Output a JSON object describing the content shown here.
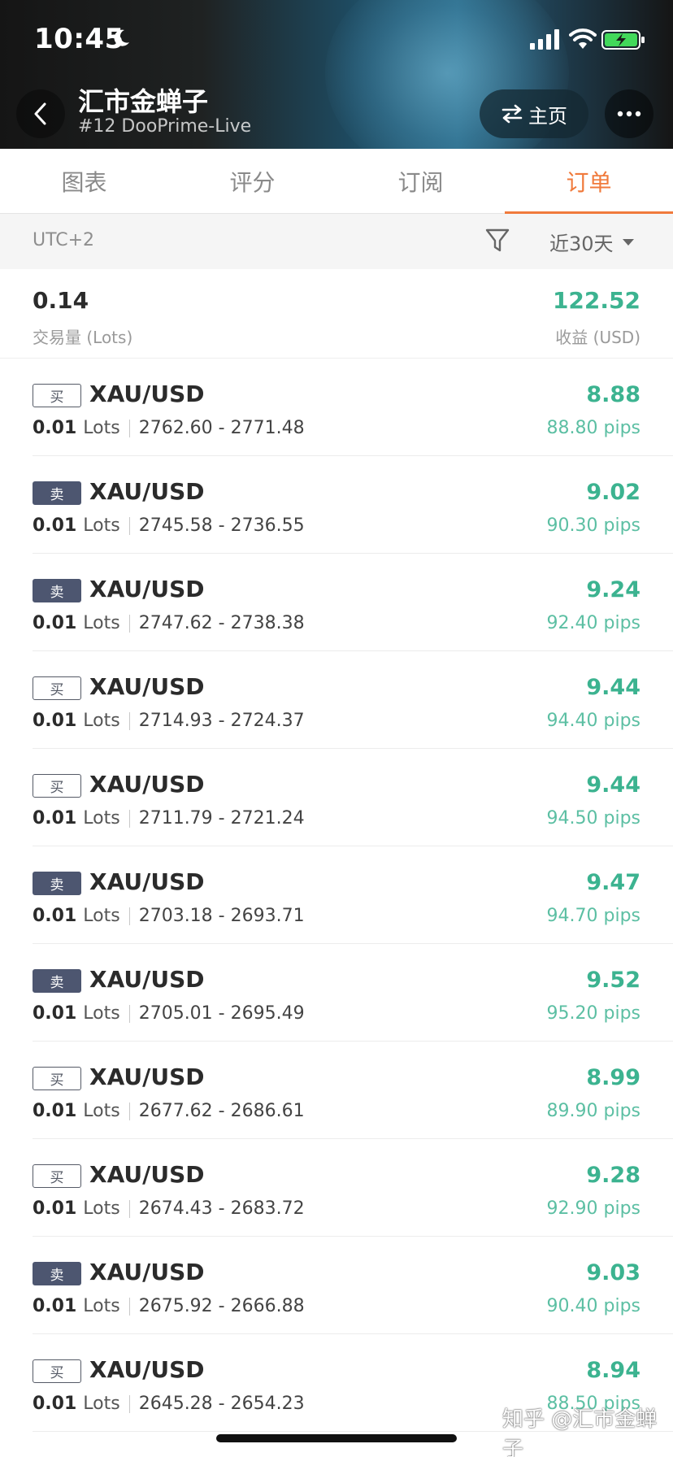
{
  "status_bar": {
    "time": "10:45"
  },
  "header": {
    "title": "汇市金蝉子",
    "subtitle": "#12 DooPrime-Live",
    "home_label": "主页"
  },
  "tabs": [
    {
      "label": "图表",
      "active": false
    },
    {
      "label": "评分",
      "active": false
    },
    {
      "label": "订阅",
      "active": false
    },
    {
      "label": "订单",
      "active": true
    }
  ],
  "filter": {
    "timezone": "UTC+2",
    "period": "近30天"
  },
  "summary": {
    "lots": "0.14",
    "lots_label": "交易量 (Lots)",
    "profit": "122.52",
    "profit_label": "收益 (USD)"
  },
  "orders": [
    {
      "side": "买",
      "type": "buy",
      "symbol": "XAU/USD",
      "lots": "0.01",
      "unit": "Lots",
      "range": "2762.60 - 2771.48",
      "profit": "8.88",
      "pips": "88.80 pips"
    },
    {
      "side": "卖",
      "type": "sell",
      "symbol": "XAU/USD",
      "lots": "0.01",
      "unit": "Lots",
      "range": "2745.58 - 2736.55",
      "profit": "9.02",
      "pips": "90.30 pips"
    },
    {
      "side": "卖",
      "type": "sell",
      "symbol": "XAU/USD",
      "lots": "0.01",
      "unit": "Lots",
      "range": "2747.62 - 2738.38",
      "profit": "9.24",
      "pips": "92.40 pips"
    },
    {
      "side": "买",
      "type": "buy",
      "symbol": "XAU/USD",
      "lots": "0.01",
      "unit": "Lots",
      "range": "2714.93 - 2724.37",
      "profit": "9.44",
      "pips": "94.40 pips"
    },
    {
      "side": "买",
      "type": "buy",
      "symbol": "XAU/USD",
      "lots": "0.01",
      "unit": "Lots",
      "range": "2711.79 - 2721.24",
      "profit": "9.44",
      "pips": "94.50 pips"
    },
    {
      "side": "卖",
      "type": "sell",
      "symbol": "XAU/USD",
      "lots": "0.01",
      "unit": "Lots",
      "range": "2703.18 - 2693.71",
      "profit": "9.47",
      "pips": "94.70 pips"
    },
    {
      "side": "卖",
      "type": "sell",
      "symbol": "XAU/USD",
      "lots": "0.01",
      "unit": "Lots",
      "range": "2705.01 - 2695.49",
      "profit": "9.52",
      "pips": "95.20 pips"
    },
    {
      "side": "买",
      "type": "buy",
      "symbol": "XAU/USD",
      "lots": "0.01",
      "unit": "Lots",
      "range": "2677.62 - 2686.61",
      "profit": "8.99",
      "pips": "89.90 pips"
    },
    {
      "side": "买",
      "type": "buy",
      "symbol": "XAU/USD",
      "lots": "0.01",
      "unit": "Lots",
      "range": "2674.43 - 2683.72",
      "profit": "9.28",
      "pips": "92.90 pips"
    },
    {
      "side": "卖",
      "type": "sell",
      "symbol": "XAU/USD",
      "lots": "0.01",
      "unit": "Lots",
      "range": "2675.92 - 2666.88",
      "profit": "9.03",
      "pips": "90.40 pips"
    },
    {
      "side": "买",
      "type": "buy",
      "symbol": "XAU/USD",
      "lots": "0.01",
      "unit": "Lots",
      "range": "2645.28 - 2654.23",
      "profit": "8.94",
      "pips": "88.50 pips"
    }
  ],
  "watermark": "知乎 @汇市金蝉子",
  "colors": {
    "accent": "#f07a3c",
    "profit": "#3cb390",
    "sell_badge": "#4d5670"
  },
  "icons": [
    "moon-icon",
    "signal-icon",
    "wifi-icon",
    "battery-icon",
    "back-icon",
    "switch-icon",
    "more-icon",
    "filter-icon",
    "caret-down-icon"
  ]
}
